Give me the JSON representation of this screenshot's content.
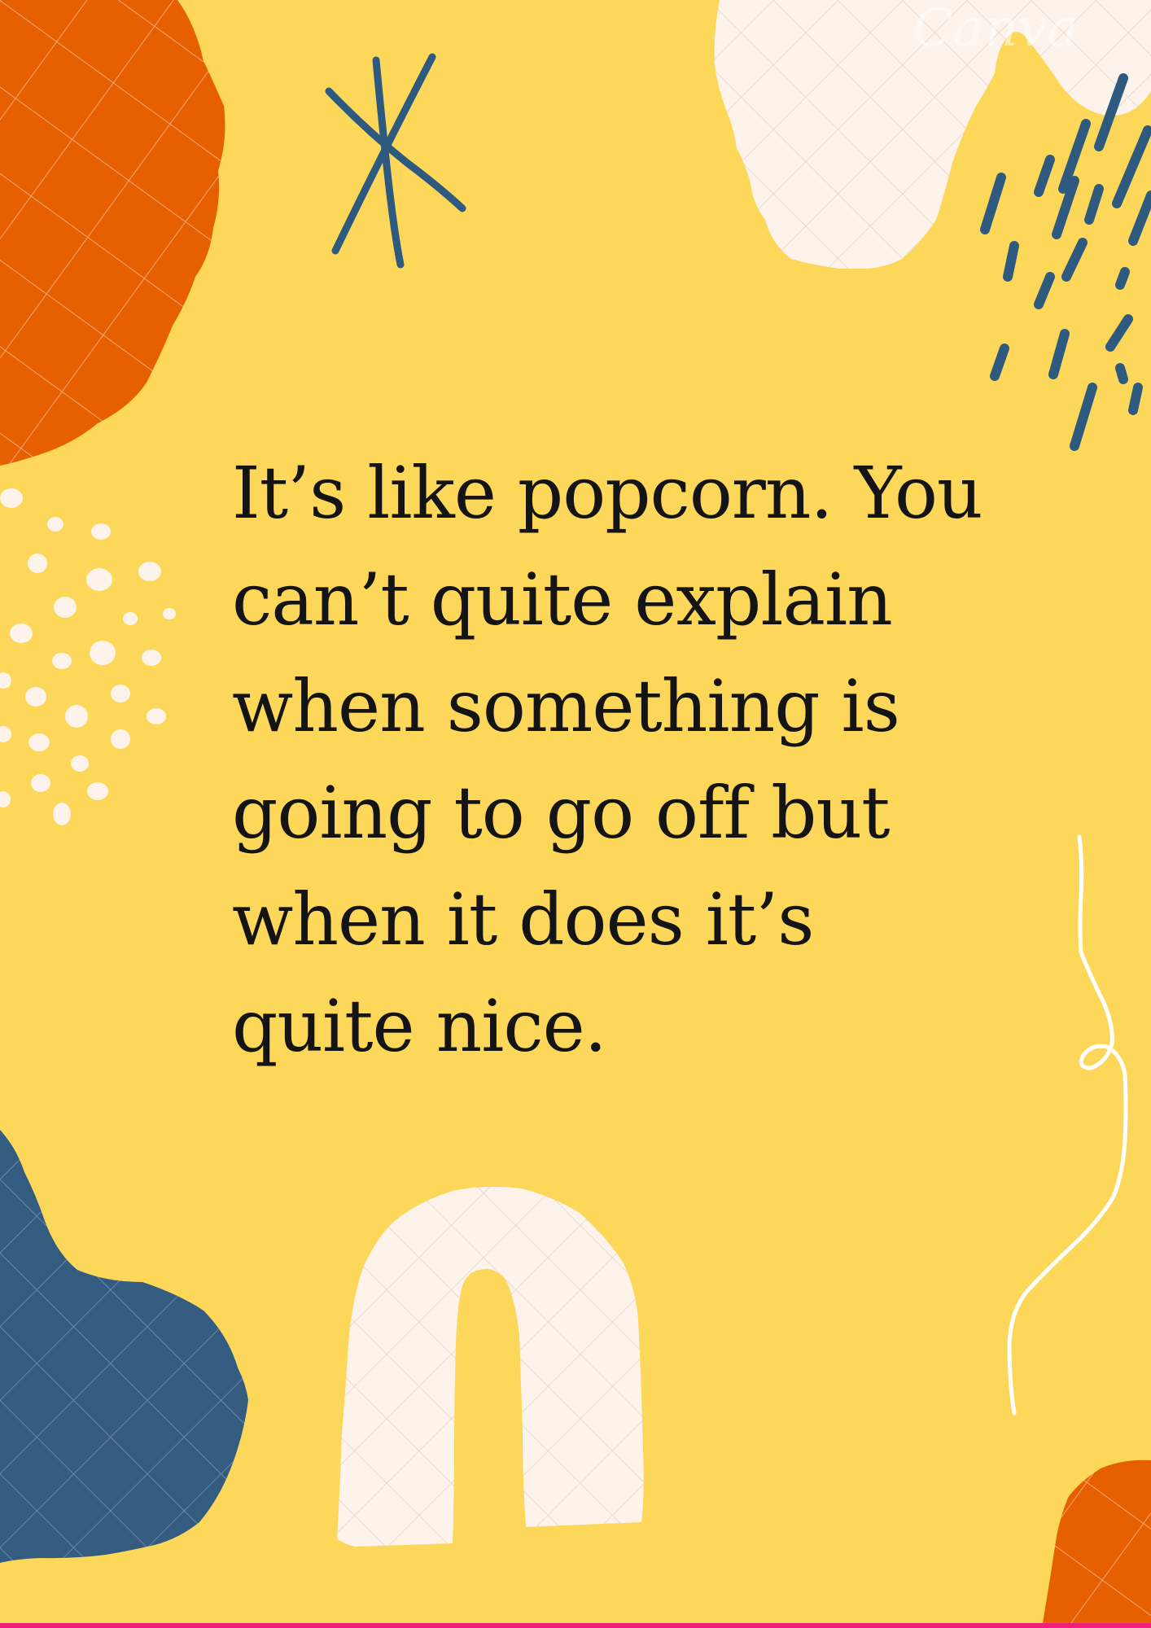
{
  "quote": {
    "text": "It’s like popcorn. You\ncan’t quite explain\nwhen something is\ngoing to go off but\nwhen it does it’s\nquite nice."
  },
  "watermark": {
    "text": "Canva"
  },
  "palette": {
    "background": "#FDD75A",
    "orange": "#E65F00",
    "navy": "#345C80",
    "cream": "#FDF3EA",
    "text": "#141414",
    "bottom_bar": "#F21F7A"
  },
  "decorations": [
    "orange-blob-icon",
    "asterisk-doodle-icon",
    "cream-blob-icon",
    "dash-rain-icon",
    "dot-cluster-icon",
    "squiggle-line-icon",
    "navy-blob-icon",
    "cream-arch-icon",
    "orange-corner-blob-icon"
  ]
}
